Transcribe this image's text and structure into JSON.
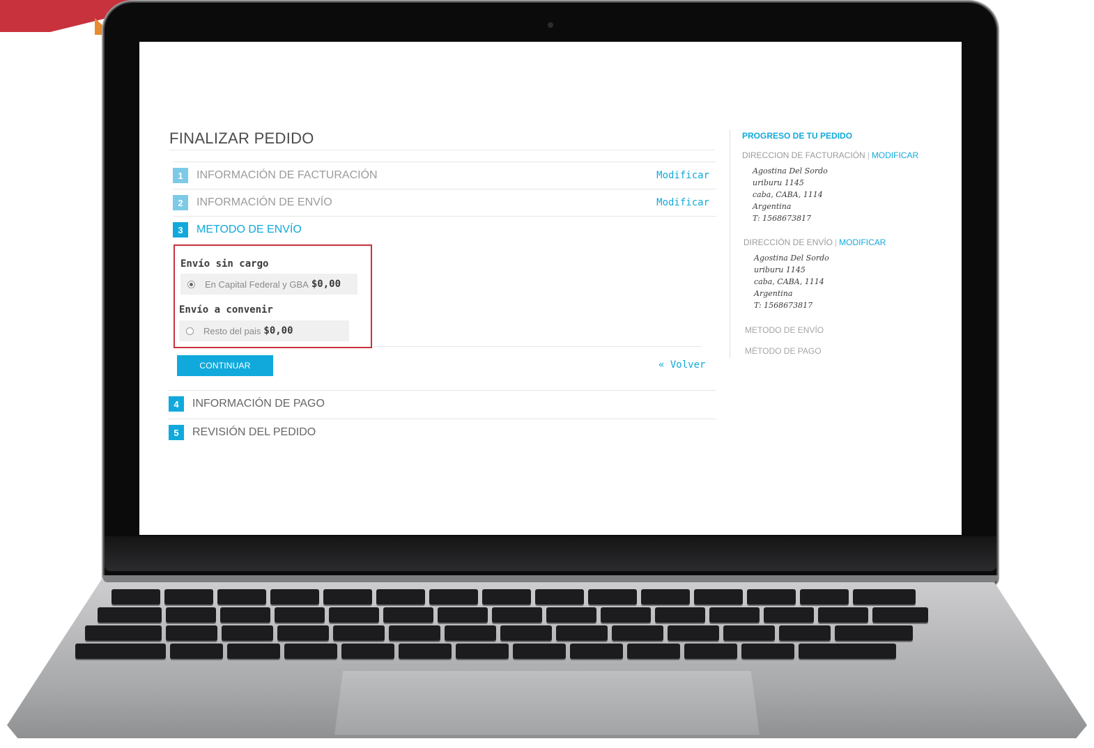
{
  "page": {
    "title": "FINALIZAR PEDIDO",
    "steps": [
      {
        "num": "1",
        "label": "INFORMACIÓN DE FACTURACIÓN",
        "action": "Modificar"
      },
      {
        "num": "2",
        "label": "INFORMACIÓN DE ENVÍO",
        "action": "Modificar"
      },
      {
        "num": "3",
        "label": "METODO DE ENVÍO"
      },
      {
        "num": "4",
        "label": "INFORMACIÓN DE PAGO"
      },
      {
        "num": "5",
        "label": "REVISIÓN DEL PEDIDO"
      }
    ],
    "shipping": {
      "group1_heading": "Envío sin cargo",
      "option1_text": "En Capital Federal y GBA",
      "option1_price": "$0,00",
      "option1_selected": true,
      "group2_heading": "Envío a convenir",
      "option2_text": "Resto del pais",
      "option2_price": "$0,00",
      "option2_selected": false
    },
    "continue_label": "CONTINUAR",
    "back_label": "« Volver"
  },
  "sidebar": {
    "title": "PROGRESO DE TU PEDIDO",
    "billing_heading": "DIRECCION DE FACTURACIÓN",
    "billing_link": "MODIFICAR",
    "billing_address": [
      "Agostina Del Sordo",
      "uriburu 1145",
      "caba, CABA, 1114",
      "Argentina",
      "T: 1568673817"
    ],
    "shipping_heading": "DIRECCIÓN DE ENVÍO",
    "shipping_link": "MODIFICAR",
    "shipping_address": [
      "Agostina Del Sordo",
      "uriburu 1145",
      "caba, CABA, 1114",
      "Argentina",
      "T: 1568673817"
    ],
    "shipping_method": "METODO DE ENVÍO",
    "payment_method": "MÉTODO DE PAGO"
  },
  "colors": {
    "accent": "#11a9dc",
    "highlight_border": "#c8323c"
  }
}
